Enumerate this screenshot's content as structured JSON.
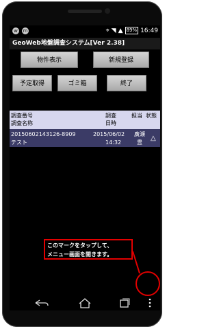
{
  "status": {
    "battery": "89%",
    "time": "16:49",
    "icon_left_1": "w",
    "icon_left_2": "m"
  },
  "app": {
    "title": "GeoWeb地盤調査システム[Ver 2.38]"
  },
  "buttons": {
    "property_display": "物件表示",
    "new_registration": "新規登録",
    "scheduled_fetch": "予定取得",
    "trash": "ゴミ箱",
    "exit": "終了"
  },
  "table": {
    "headers": {
      "survey_number": "調査番号",
      "survey_name": "調査名称",
      "survey_date_line1": "調査",
      "survey_date_line2": "日時",
      "person": "担当",
      "status": "状態"
    },
    "rows": [
      {
        "number": "20150602143126-8909",
        "name": "テスト",
        "date": "2015/06/02",
        "time": "14:32",
        "person_line1": "廣瀬",
        "person_line2": "豊",
        "status": "△"
      }
    ]
  },
  "callout": {
    "line1": "このマークをタップして、",
    "line2": "メニュー画面を開きます。"
  },
  "colors": {
    "callout_border": "#e30000",
    "row_bg": "#3b3b66",
    "header_bg": "#d7d7ef"
  }
}
